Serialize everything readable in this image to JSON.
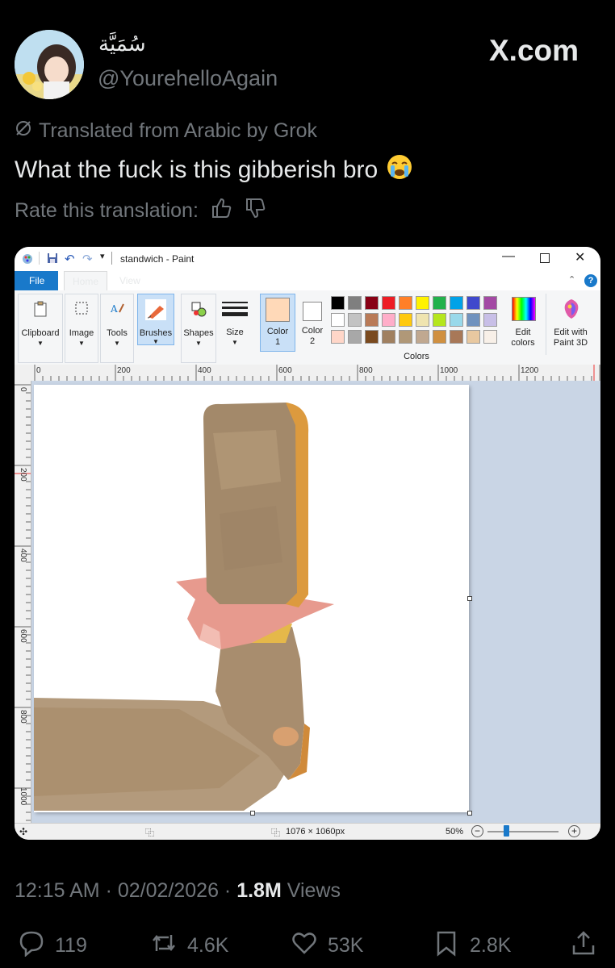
{
  "author": {
    "display_name": "سُمَيَّة",
    "handle": "@YourehelloAgain",
    "avatar": "avatar-anime-girl"
  },
  "brand": "X.com",
  "translation": {
    "note": "Translated from Arabic by Grok",
    "text": "What the fuck is this gibberish bro",
    "emoji": "😭",
    "rate_label": "Rate this translation:"
  },
  "paint": {
    "title": "standwich - Paint",
    "menu": [
      "File",
      "Home",
      "View"
    ],
    "groups": {
      "clipboard": "Clipboard",
      "image": "Image",
      "tools": "Tools",
      "brushes": "Brushes",
      "shapes": "Shapes",
      "size": "Size",
      "color1": "Color",
      "color1_num": "1",
      "color2": "Color",
      "color2_num": "2",
      "colors_label": "Colors",
      "edit_colors_1": "Edit",
      "edit_colors_2": "colors",
      "edit_paint3d_1": "Edit with",
      "edit_paint3d_2": "Paint 3D"
    },
    "ruler_h_labels": [
      "0",
      "200",
      "400",
      "600",
      "800",
      "1000",
      "1200"
    ],
    "ruler_v_labels": [
      "0",
      "200",
      "400",
      "600",
      "800",
      "1000"
    ],
    "image_size": "1076 × 1060px",
    "zoom": "50%",
    "palette_row1": [
      "#000000",
      "#7f7f7f",
      "#880015",
      "#ed1c24",
      "#ff7f27",
      "#fff200",
      "#22b14c",
      "#00a2e8",
      "#3f48cc",
      "#a349a4"
    ],
    "palette_row2": [
      "#ffffff",
      "#c3c3c3",
      "#b97a57",
      "#ffaec9",
      "#ffc90e",
      "#efe4b0",
      "#b5e61d",
      "#99d9ea",
      "#7092be",
      "#c8bfe7"
    ],
    "palette_row3": [
      "#ffd6c8",
      "#a8a8a8",
      "#7a4a1f",
      "#a08060",
      "#b09878",
      "#c0a890",
      "#d09040",
      "#a87858",
      "#e8c8a0",
      "#f8f0e8"
    ]
  },
  "timestamp": "12:15 AM · 02/02/2026 · ",
  "views_count": "1.8M",
  "views_label": "Views",
  "actions": {
    "replies": "119",
    "reposts": "4.6K",
    "likes": "53K",
    "bookmarks": "2.8K"
  }
}
